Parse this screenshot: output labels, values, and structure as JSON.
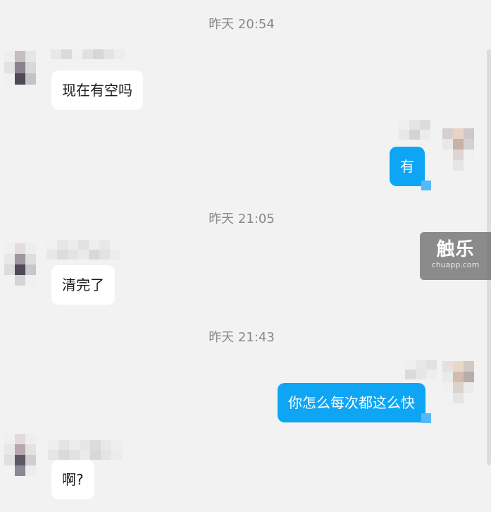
{
  "messages": [
    {
      "type": "time",
      "text": "昨天 20:54"
    },
    {
      "type": "incoming",
      "text": "现在有空吗"
    },
    {
      "type": "outgoing",
      "text": "有"
    },
    {
      "type": "time",
      "text": "昨天 21:05"
    },
    {
      "type": "incoming",
      "text": "清完了"
    },
    {
      "type": "time",
      "text": "昨天 21:43"
    },
    {
      "type": "outgoing",
      "text": "你怎么每次都这么快"
    },
    {
      "type": "incoming",
      "text": "啊?"
    }
  ],
  "watermark": {
    "brand": "触乐",
    "site": "chuapp.com"
  },
  "colors": {
    "outgoing_bubble": "#0ea5f5",
    "incoming_bubble": "#ffffff",
    "background": "#f2f2f2"
  }
}
